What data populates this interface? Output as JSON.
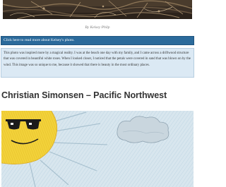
{
  "photo": {
    "credit": "By Kelsey Philp"
  },
  "read_more": {
    "label": "Click here to read more about Kelsey's photo."
  },
  "description": {
    "text": "This photo was inspired more by a magical reality. I was at the beach one day with my family, and I came across a driftwood structure that was covered in beautiful white roses. When I looked closer, I noticed that the petals were covered in sand that was blown on by the wind. This image was so unique to me, because it showed that there is beauty in the most ordinary places."
  },
  "section": {
    "title": "Christian Simonsen – Pacific Northwest"
  },
  "colors": {
    "read_more_bar": "#2b6a9b",
    "description_bg": "#dbe9f4",
    "title_text": "#333333"
  }
}
